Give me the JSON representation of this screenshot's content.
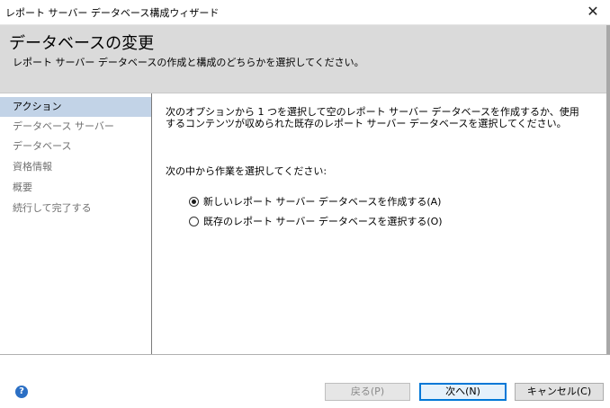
{
  "window": {
    "title": "レポート サーバー データベース構成ウィザード",
    "close_glyph": "✕"
  },
  "header": {
    "title": "データベースの変更",
    "subtitle": "レポート サーバー データベースの作成と構成のどちらかを選択してください。"
  },
  "sidebar": {
    "items": [
      {
        "label": "アクション",
        "selected": true
      },
      {
        "label": "データベース サーバー",
        "selected": false
      },
      {
        "label": "データベース",
        "selected": false
      },
      {
        "label": "資格情報",
        "selected": false
      },
      {
        "label": "概要",
        "selected": false
      },
      {
        "label": "続行して完了する",
        "selected": false
      }
    ]
  },
  "main": {
    "description": "次のオプションから 1 つを選択して空のレポート サーバー データベースを作成するか、使用するコンテンツが収められた既存のレポート サーバー データベースを選択してください。",
    "prompt": "次の中から作業を選択してください:",
    "options": [
      {
        "label": "新しいレポート サーバー データベースを作成する(A)",
        "checked": true
      },
      {
        "label": "既存のレポート サーバー データベースを選択する(O)",
        "checked": false
      }
    ]
  },
  "footer": {
    "help_glyph": "?",
    "back_label": "戻る(P)",
    "next_label": "次へ(N)",
    "cancel_label": "キャンセル(C)"
  },
  "colors": {
    "header_bg": "#dadada",
    "selected_nav_bg": "#c2d3e7",
    "default_button_border": "#0078d7",
    "help_icon": "#2b6fc4"
  },
  "icons": {
    "close": "close-icon",
    "help": "help-icon"
  }
}
